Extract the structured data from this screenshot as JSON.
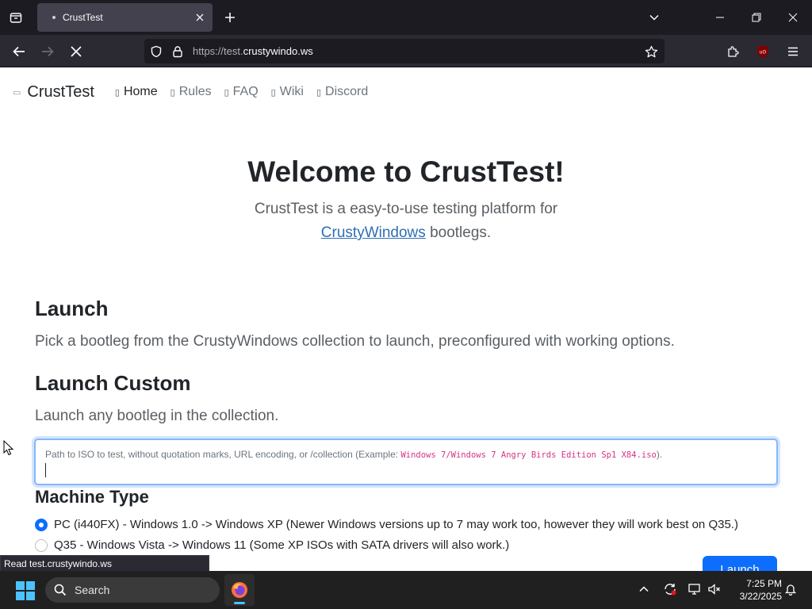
{
  "browser": {
    "tab_title": "CrustTest",
    "url_prefix": "https://test.",
    "url_domain": "crustywindo.ws",
    "status_url": "Read test.crustywindo.ws",
    "icons": {
      "tab_list": "tab-list-icon",
      "close_tab": "close-icon",
      "new_tab": "plus-icon",
      "back": "back-arrow-icon",
      "forward": "forward-arrow-icon",
      "stop": "stop-x-icon",
      "tracking": "shield-icon",
      "lock": "lock-icon",
      "bookmark": "star-icon",
      "extensions": "puzzle-icon",
      "ublock": "ublock-icon",
      "menu": "hamburger-icon"
    }
  },
  "site": {
    "brand": "CrustTest",
    "nav": [
      {
        "label": "Home",
        "active": true
      },
      {
        "label": "Rules",
        "active": false
      },
      {
        "label": "FAQ",
        "active": false
      },
      {
        "label": "Wiki",
        "active": false
      },
      {
        "label": "Discord",
        "active": false
      }
    ]
  },
  "hero": {
    "title": "Welcome to CrustTest!",
    "subtitle_before": "CrustTest is a easy-to-use testing platform for",
    "subtitle_link": "CrustyWindows",
    "subtitle_after": "bootlegs."
  },
  "launch": {
    "heading": "Launch",
    "description": "Pick a bootleg from the CrustyWindows collection to launch, preconfigured with working options."
  },
  "launch_custom": {
    "heading": "Launch Custom",
    "description": "Launch any bootleg in the collection.",
    "placeholder_before": "Path to ISO to test, without quotation marks, URL encoding, or /collection (Example: ",
    "placeholder_example": "Windows 7/Windows 7 Angry Birds Edition Sp1 X84.iso",
    "placeholder_after": ")."
  },
  "machine_type": {
    "heading": "Machine Type",
    "options": [
      {
        "label": "PC (i440FX) - Windows 1.0 -> Windows XP (Newer Windows versions up to 7 may work too, however they will work best on Q35.)",
        "checked": true
      },
      {
        "label": "Q35 - Windows Vista -> Windows 11 (Some XP ISOs with SATA drivers will also work.)",
        "checked": false
      }
    ],
    "launch_button": "Launch"
  },
  "taskbar": {
    "search_label": "Search",
    "time": "7:25 PM",
    "date": "3/22/2025"
  },
  "colors": {
    "primary": "#0d6efd",
    "link": "#2f6fb3",
    "code": "#d63384",
    "browser_bg": "#1c1b22",
    "taskbar_bg": "#202020"
  }
}
